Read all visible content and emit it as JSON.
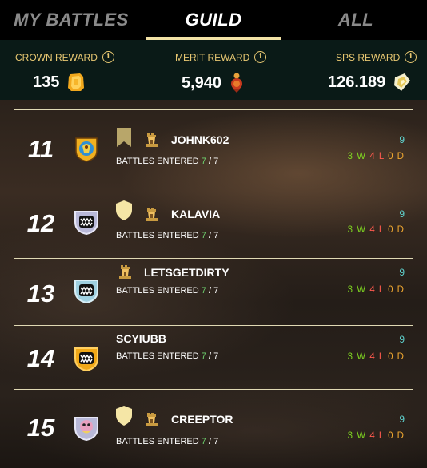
{
  "tabs": [
    {
      "label": "MY BATTLES",
      "active": false
    },
    {
      "label": "GUILD",
      "active": true
    },
    {
      "label": "ALL",
      "active": false
    }
  ],
  "rewards": {
    "crown": {
      "label": "CROWN REWARD",
      "value": "135",
      "icon": "crown-reward-icon"
    },
    "merit": {
      "label": "MERIT REWARD",
      "value": "5,940",
      "icon": "merit-reward-icon"
    },
    "sps": {
      "label": "SPS REWARD",
      "value": "126.189",
      "icon": "sps-token-icon"
    }
  },
  "entries_label": "BATTLES ENTERED",
  "players": [
    {
      "rank": "11",
      "name": "JOHNK602",
      "entered": "7",
      "total": "7",
      "points": "9",
      "wins": "3 W",
      "losses": "4 L",
      "draws": "0 D",
      "badge": "bronze-banner"
    },
    {
      "rank": "12",
      "name": "KALAVIA",
      "entered": "7",
      "total": "7",
      "points": "9",
      "wins": "3 W",
      "losses": "4 L",
      "draws": "0 D",
      "badge": "gold-shield"
    },
    {
      "rank": "13",
      "name": "LETSGETDIRTY",
      "entered": "7",
      "total": "7",
      "points": "9",
      "wins": "3 W",
      "losses": "4 L",
      "draws": "0 D",
      "badge": "none"
    },
    {
      "rank": "14",
      "name": "SCYIUBB",
      "entered": "7",
      "total": "7",
      "points": "9",
      "wins": "3 W",
      "losses": "4 L",
      "draws": "0 D",
      "badge": "none"
    },
    {
      "rank": "15",
      "name": "CREEPTOR",
      "entered": "7",
      "total": "7",
      "points": "9",
      "wins": "3 W",
      "losses": "4 L",
      "draws": "0 D",
      "badge": "gold-shield"
    }
  ],
  "colors": {
    "accent": "#f2e2a6",
    "gold_label": "#e8c872",
    "win": "#7ed321",
    "loss": "#ff5a4e",
    "draw": "#f0a830",
    "points": "#5fd3cf",
    "entered": "#6fd46f"
  }
}
